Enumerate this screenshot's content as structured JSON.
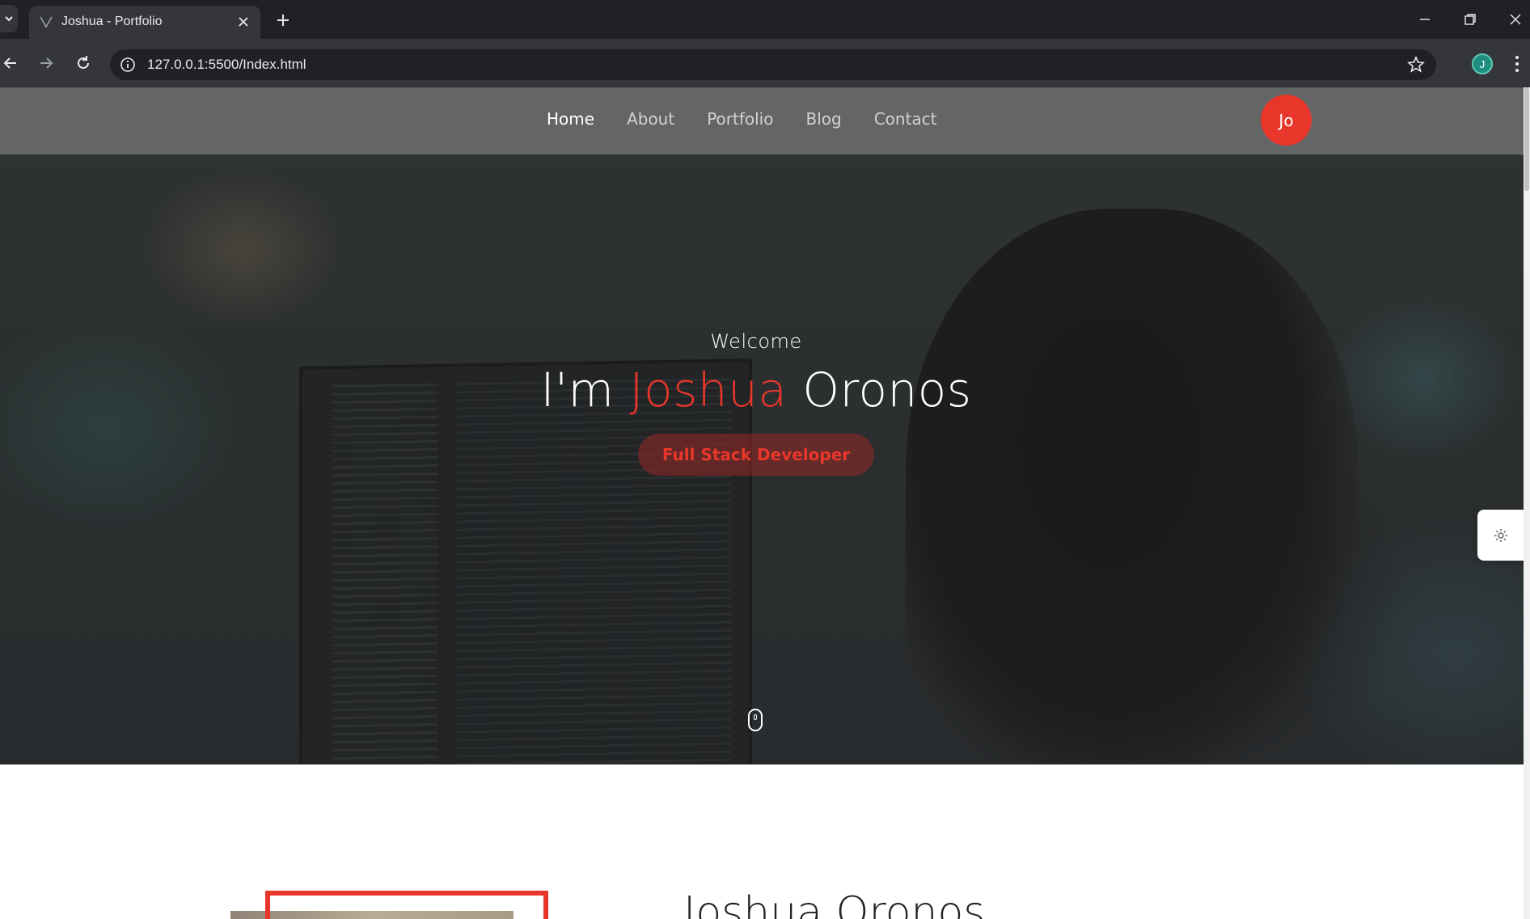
{
  "browser": {
    "tab_title": "Joshua - Portfolio",
    "url": "127.0.0.1:5500/Index.html",
    "profile_initial": "J"
  },
  "navbar": {
    "links": [
      {
        "label": "Home",
        "active": true
      },
      {
        "label": "About",
        "active": false
      },
      {
        "label": "Portfolio",
        "active": false
      },
      {
        "label": "Blog",
        "active": false
      },
      {
        "label": "Contact",
        "active": false
      }
    ],
    "logo_text": "Jo"
  },
  "hero": {
    "welcome": "Welcome",
    "name_prefix": "I'm",
    "first_name": "Joshua",
    "last_name": "Oronos",
    "role": "Full Stack Developer"
  },
  "about": {
    "title": "Joshua Oronos"
  },
  "colors": {
    "accent": "#e8372a",
    "navbar": "#69696b",
    "chrome_dark": "#202124",
    "chrome_toolbar": "#35363a"
  },
  "icons": [
    "chevron-down-icon",
    "vercel-favicon-icon",
    "close-icon",
    "plus-icon",
    "minimize-icon",
    "restore-icon",
    "back-arrow-icon",
    "forward-arrow-icon",
    "reload-icon",
    "info-icon",
    "star-icon",
    "kebab-menu-icon",
    "gear-icon",
    "mouse-scroll-icon"
  ]
}
